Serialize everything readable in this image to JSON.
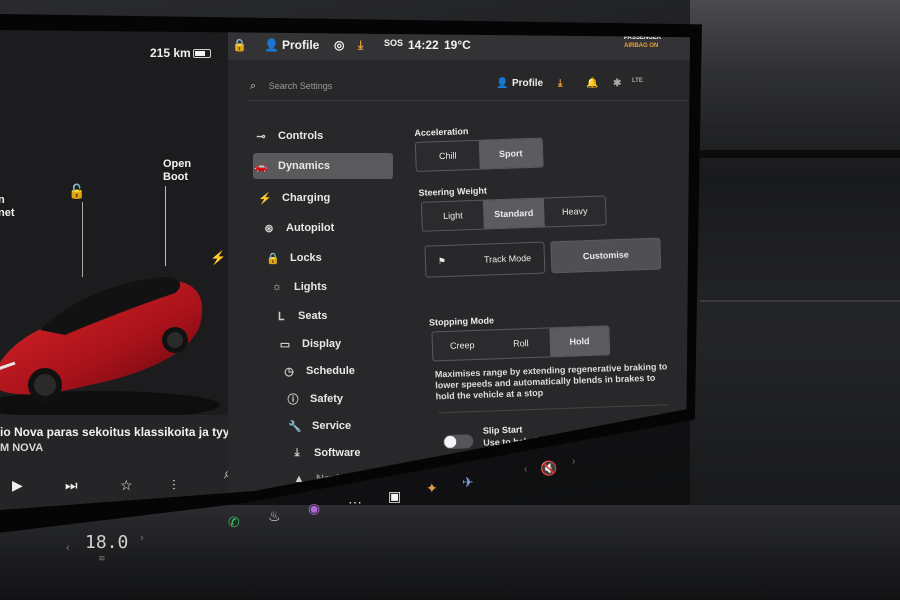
{
  "left_panel": {
    "range": "215 km",
    "open_boot": [
      "Open",
      "Boot"
    ],
    "frunk_partial": [
      "n",
      "net"
    ],
    "media_title": "io Nova paras sekoitus klassikoita ja tyylikkäi",
    "media_sub": "M NOVA"
  },
  "top_bar": {
    "profile": "Profile",
    "time": "14:22",
    "temperature": "19°C",
    "sos": "SOS",
    "airbag": [
      "PASSENGER",
      "AIRBAG ON"
    ]
  },
  "search_bar": {
    "placeholder": "Search Settings",
    "profile": "Profile",
    "lte": "LTE"
  },
  "menu": [
    {
      "label": "Controls",
      "icon": "toggle-icon"
    },
    {
      "label": "Dynamics",
      "icon": "car-icon",
      "active": true
    },
    {
      "label": "Charging",
      "icon": "bolt-icon"
    },
    {
      "label": "Autopilot",
      "icon": "steering-wheel-icon"
    },
    {
      "label": "Locks",
      "icon": "lock-icon"
    },
    {
      "label": "Lights",
      "icon": "sun-icon"
    },
    {
      "label": "Seats",
      "icon": "seat-icon"
    },
    {
      "label": "Display",
      "icon": "display-icon"
    },
    {
      "label": "Schedule",
      "icon": "clock-icon"
    },
    {
      "label": "Safety",
      "icon": "info-icon"
    },
    {
      "label": "Service",
      "icon": "wrench-icon"
    },
    {
      "label": "Software",
      "icon": "download-icon"
    },
    {
      "label": "Navigation",
      "icon": "navigation-icon"
    }
  ],
  "dynamics": {
    "acceleration": {
      "title": "Acceleration",
      "options": [
        "Chill",
        "Sport"
      ],
      "selected": "Sport"
    },
    "steering": {
      "title": "Steering Weight",
      "options": [
        "Light",
        "Standard",
        "Heavy"
      ],
      "selected": "Standard"
    },
    "track_mode": "Track Mode",
    "customise": "Customise",
    "stopping": {
      "title": "Stopping Mode",
      "options": [
        "Creep",
        "Roll",
        "Hold"
      ],
      "selected": "Hold"
    },
    "stopping_desc": "Maximises range by extending regenerative braking to lower speeds and automatically blends in brakes to hold the vehicle at a stop",
    "slip_title": "Slip Start",
    "slip_desc": "Use to help free vehicle stuck in snow, sand or mud.",
    "slip_enabled": false
  },
  "dock": {
    "cabin_temp": "18.0"
  },
  "colors": {
    "car_red": "#c4161c",
    "accent_orange": "#e8a03c",
    "phone_green": "#3ac45e"
  }
}
